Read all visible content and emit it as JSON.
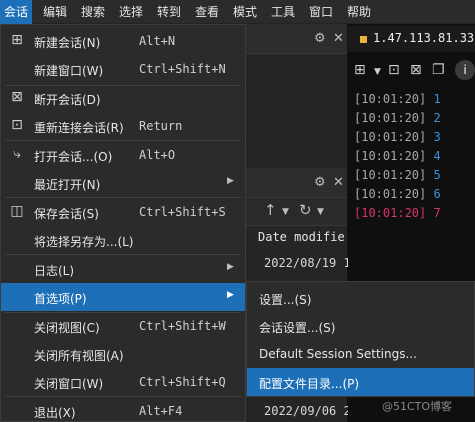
{
  "menubar": {
    "items": [
      "会话",
      "编辑",
      "搜索",
      "选择",
      "转到",
      "查看",
      "模式",
      "工具",
      "窗口",
      "帮助"
    ]
  },
  "session_menu": {
    "items": [
      {
        "label": "新建会话(N)",
        "shortcut": "Alt+N",
        "icon": "new-session-icon"
      },
      {
        "label": "新建窗口(W)",
        "shortcut": "Ctrl+Shift+N",
        "icon": ""
      },
      {
        "label": "断开会话(D)",
        "shortcut": "",
        "icon": "disconnect-icon"
      },
      {
        "label": "重新连接会话(R)",
        "shortcut": "Return",
        "icon": "reconnect-icon"
      },
      {
        "label": "打开会话...(O)",
        "shortcut": "Alt+O",
        "icon": "open-session-icon"
      },
      {
        "label": "最近打开(N)",
        "shortcut": "",
        "icon": "",
        "submenu": true
      },
      {
        "label": "保存会话(S)",
        "shortcut": "Ctrl+Shift+S",
        "icon": "save-icon"
      },
      {
        "label": "将选择另存为...(L)",
        "shortcut": "",
        "icon": ""
      },
      {
        "label": "日志(L)",
        "shortcut": "",
        "icon": "",
        "submenu": true
      },
      {
        "label": "首选项(P)",
        "shortcut": "",
        "icon": "",
        "submenu": true,
        "active": true
      },
      {
        "label": "关闭视图(C)",
        "shortcut": "Ctrl+Shift+W",
        "icon": ""
      },
      {
        "label": "关闭所有视图(A)",
        "shortcut": "",
        "icon": ""
      },
      {
        "label": "关闭窗口(W)",
        "shortcut": "Ctrl+Shift+Q",
        "icon": ""
      },
      {
        "label": "退出(X)",
        "shortcut": "Alt+F4",
        "icon": ""
      }
    ]
  },
  "preferences_submenu": {
    "items": [
      "设置...(S)",
      "会话设置...(S)",
      "Default Session Settings...",
      "配置文件目录...(P)"
    ]
  },
  "file_pane": {
    "column_header": "Date modifie",
    "rows": [
      "2022/08/19 1",
      "2022/09/06 2"
    ]
  },
  "terminal": {
    "tab_label": "1.47.113.81.33",
    "lines": [
      {
        "time": "[10:01:20]",
        "num": "1"
      },
      {
        "time": "[10:01:20]",
        "num": "2"
      },
      {
        "time": "[10:01:20]",
        "num": "3"
      },
      {
        "time": "[10:01:20]",
        "num": "4"
      },
      {
        "time": "[10:01:20]",
        "num": "5"
      },
      {
        "time": "[10:01:20]",
        "num": "6"
      },
      {
        "time": "[10:01:20]",
        "num": "7",
        "highlight": true
      }
    ],
    "colors": {
      "line_number": "#3c8fd8",
      "highlight": "#d6336c",
      "tab_dot": "#e8b43a"
    }
  },
  "watermark": "@51CTO博客",
  "accent_color": "#1d6fb8"
}
